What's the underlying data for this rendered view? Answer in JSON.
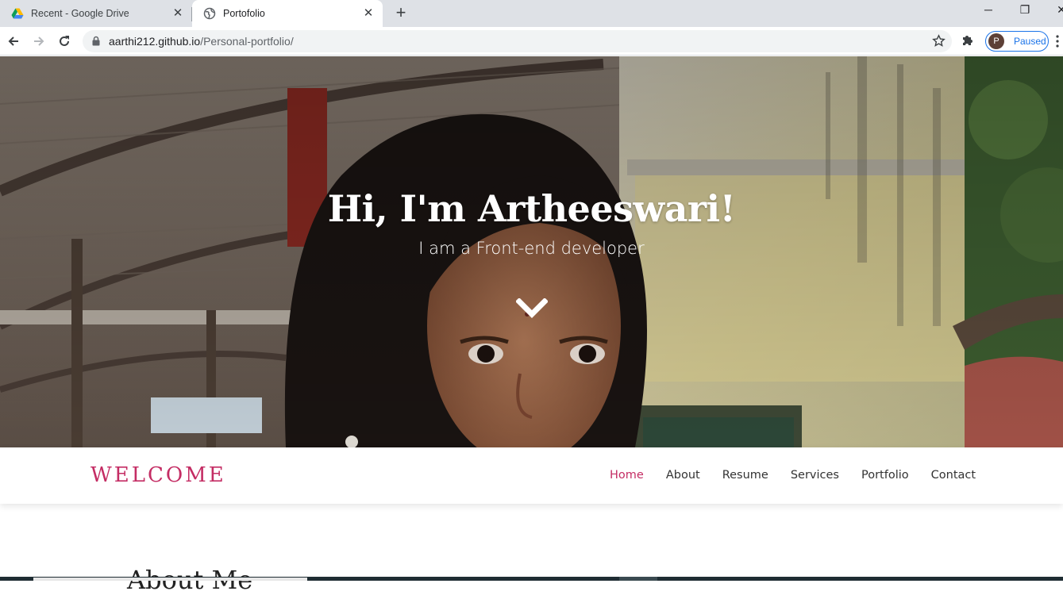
{
  "browser": {
    "tabs": [
      {
        "title": "Recent - Google Drive",
        "favicon": "google-drive-icon",
        "active": false
      },
      {
        "title": "Portofolio",
        "favicon": "globe-icon",
        "active": true
      }
    ],
    "url": {
      "host": "aarthi212.github.io",
      "path": "/Personal-portfolio/"
    },
    "profile": {
      "initial": "P",
      "status": "Paused"
    }
  },
  "hero": {
    "title": "Hi, I'm Artheeswari!",
    "subtitle": "I am a Front-end developer",
    "scroll_icon": "chevron-down-icon"
  },
  "navbar": {
    "brand": "WELCOME",
    "links": [
      {
        "label": "Home",
        "active": true
      },
      {
        "label": "About",
        "active": false
      },
      {
        "label": "Resume",
        "active": false
      },
      {
        "label": "Services",
        "active": false
      },
      {
        "label": "Portfolio",
        "active": false
      },
      {
        "label": "Contact",
        "active": false
      }
    ]
  },
  "about": {
    "heading": "About Me"
  },
  "colors": {
    "accent": "#c42d64",
    "chrome": "#dee1e6",
    "profile_ring": "#1a73e8"
  }
}
